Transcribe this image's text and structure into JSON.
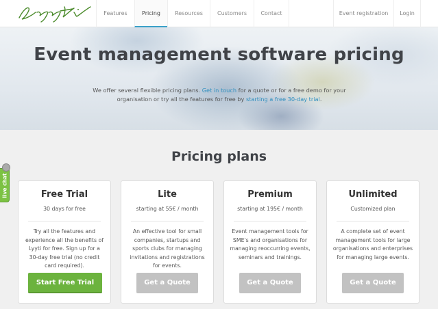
{
  "nav": {
    "logo_text": "Lyyti",
    "items": [
      "Features",
      "Pricing",
      "Resources",
      "Customers",
      "Contact"
    ],
    "active": "Pricing",
    "right_items": [
      "Event registration",
      "Login"
    ]
  },
  "hero": {
    "title": "Event management software pricing",
    "text_1": "We offer several flexible pricing plans. ",
    "link_contact": "Get in touch",
    "text_2": " for a quote or for a free demo for your organisation or try all the features for free by ",
    "link_trial": "starting a free 30-day trial",
    "text_3": "."
  },
  "pricing": {
    "title": "Pricing plans",
    "plans": [
      {
        "name": "Free Trial",
        "price": "30 days for free",
        "description": "Try all the features and experience all the benefits of Lyyti for free. Sign up for a 30-day free trial (no credit card required).",
        "button": "Start Free Trial"
      },
      {
        "name": "Lite",
        "price": "starting at 55€ / month",
        "description": "An effective tool for small companies, startups and sports clubs for managing invitations and registrations for events.",
        "button": "Get a Quote"
      },
      {
        "name": "Premium",
        "price": "starting at 195€ / month",
        "description": "Event management tools for SME's and organisations for managing reoccurring events, seminars and trainings.",
        "button": "Get a Quote"
      },
      {
        "name": "Unlimited",
        "price": "Customized plan",
        "description": "A complete set of event management tools for large organisations and enterprises for managing large events.",
        "button": "Get a Quote"
      }
    ]
  },
  "livechat": {
    "label": "live chat"
  },
  "colors": {
    "accent_link": "#2f8fbf",
    "primary_button": "#6cb33e",
    "secondary_button": "#c2c2c2",
    "livechat": "#7cc243"
  }
}
